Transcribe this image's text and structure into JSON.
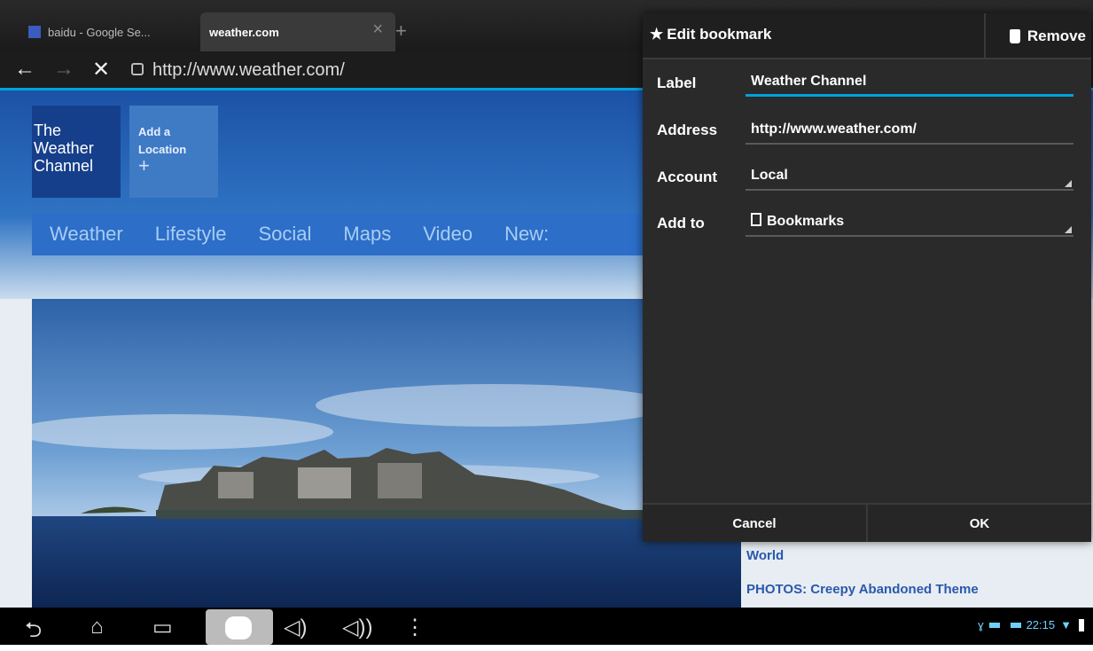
{
  "browser": {
    "tabs": [
      {
        "label": "baidu - Google Se..."
      },
      {
        "label": "weather.com",
        "close": "×"
      }
    ],
    "new_tab": "+",
    "url": "http://www.weather.com/"
  },
  "page": {
    "logo_lines": [
      "The",
      "Weather",
      "Channel"
    ],
    "add_location": [
      "Add a",
      "Location"
    ],
    "nav": [
      "Weather",
      "Lifestyle",
      "Social",
      "Maps",
      "Video",
      "New:"
    ],
    "news": [
      "World",
      "PHOTOS: Creepy Abandoned Theme"
    ]
  },
  "dialog": {
    "title": "Edit bookmark",
    "remove": "Remove",
    "fields": {
      "label": {
        "label": "Label",
        "value": "Weather Channel"
      },
      "address": {
        "label": "Address",
        "value": "http://www.weather.com/"
      },
      "account": {
        "label": "Account",
        "value": "Local"
      },
      "add_to": {
        "label": "Add to",
        "value": "Bookmarks"
      }
    },
    "cancel": "Cancel",
    "ok": "OK"
  },
  "status": {
    "time": "22:15"
  },
  "colors": {
    "accent": "#00a3d9",
    "link": "#2b58ad"
  }
}
